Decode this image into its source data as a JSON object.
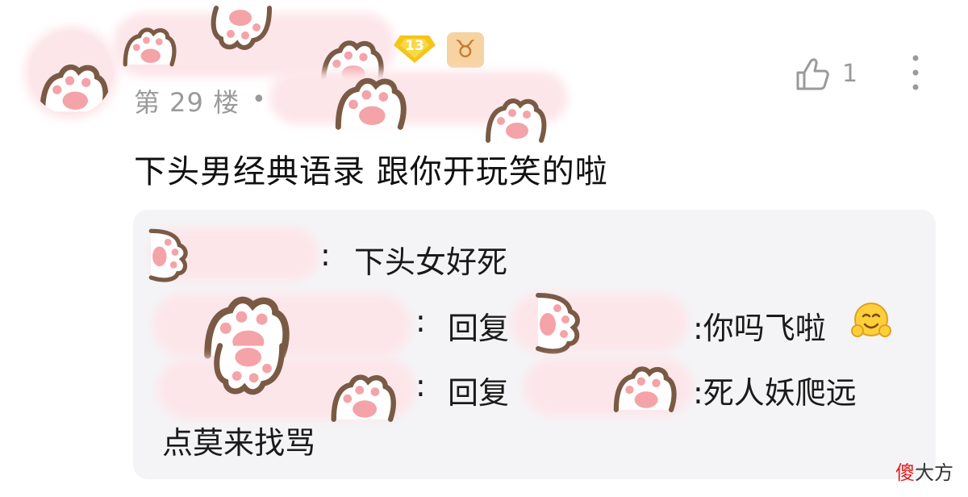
{
  "post": {
    "level_badge": "13",
    "zodiac_symbol": "♉",
    "floor_label": "第 29 楼",
    "separator": "•",
    "like_count": "1",
    "content": "下头男经典语录 跟你开玩笑的啦"
  },
  "replies": [
    {
      "colon": ":",
      "text": "下头女好死"
    },
    {
      "colon": ":",
      "reply_word": "回复",
      "text": ":你吗飞啦",
      "emoji": "smiling-hug-emoji"
    },
    {
      "colon": ":",
      "reply_word": "回复",
      "text": ":死人妖爬远",
      "continuation": "点莫来找骂"
    }
  ],
  "watermark": {
    "first_char": "傻",
    "rest": "大方"
  },
  "colors": {
    "sticker_pink": "#fde6ea",
    "paw_brown": "#7a5a44",
    "paw_pad": "#f4a3a8",
    "level_badge": "#f5c518",
    "zodiac_bg": "#f6d3a0",
    "zodiac_fg": "#c8782b",
    "meta_gray": "#9a9a9a",
    "reply_bg": "#f4f4f6"
  },
  "icons": {
    "like": "thumbs-up-icon",
    "more": "more-vertical-icon"
  }
}
